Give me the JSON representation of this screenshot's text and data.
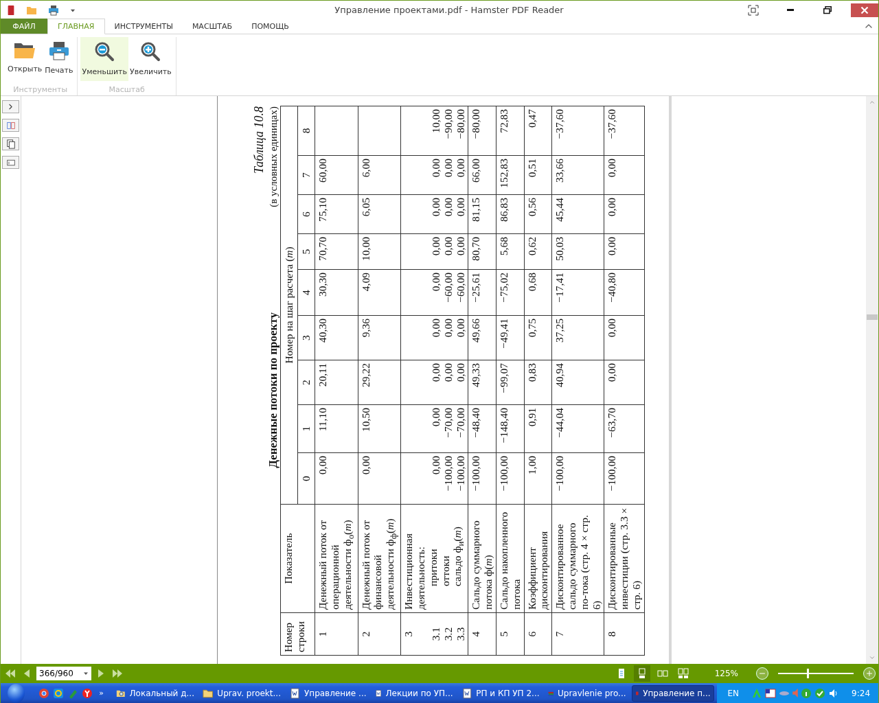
{
  "window": {
    "title": "Управление проектами.pdf - Hamster PDF Reader"
  },
  "tabs": [
    {
      "label": "ФАЙЛ",
      "kind": "file",
      "selected": false
    },
    {
      "label": "ГЛАВНАЯ",
      "kind": "tab",
      "selected": true
    },
    {
      "label": "ИНСТРУМЕНТЫ",
      "kind": "tab",
      "selected": false
    },
    {
      "label": "МАСШТАБ",
      "kind": "tab",
      "selected": false
    },
    {
      "label": "ПОМОЩЬ",
      "kind": "tab",
      "selected": false
    }
  ],
  "ribbon_groups": [
    {
      "label": "Инструменты",
      "buttons": [
        {
          "label": "Открыть",
          "kind": "open",
          "highlighted": false
        },
        {
          "label": "Печать",
          "kind": "print",
          "highlighted": false
        }
      ]
    },
    {
      "label": "Масштаб",
      "buttons": [
        {
          "label": "Уменьшить",
          "kind": "zoom-out",
          "highlighted": true
        },
        {
          "label": "Увеличить",
          "kind": "zoom-in",
          "highlighted": false
        }
      ]
    }
  ],
  "document": {
    "table_label": "Таблица 10.8",
    "title": "Денежные потоки по проекту",
    "units": "(в условных единицах)",
    "columns": [
      "Номер строки",
      "Показатель"
    ],
    "step_header": "Номер на шаг расчета (*m*)",
    "steps": [
      "0",
      "1",
      "2",
      "3",
      "4",
      "5",
      "6",
      "7",
      "8"
    ],
    "rows": [
      {
        "kind": "plain",
        "number": "1",
        "indicator": "Денежный поток от операционной деятельности ф$_{о}$(*m*)",
        "values": [
          "0,00",
          "11,10",
          "20,11",
          "40,30",
          "30,30",
          "70,70",
          "75,10",
          "60,00"
        ]
      },
      {
        "kind": "plain",
        "number": "2",
        "indicator": "Денежный поток от финансовой деятельности ф$_{ф}$(*m*)",
        "values": [
          "0,00",
          "10,50",
          "29,22",
          "9,36",
          "4,09",
          "10,00",
          "6,05",
          "6,00"
        ]
      },
      {
        "kind": "group",
        "number": "3",
        "indicator": "Инвестиционная деятельность:",
        "subrows": [
          {
            "number": "3.1",
            "indicator": "притоки",
            "values": [
              "0,00",
              "0,00",
              "0,00",
              "0,00",
              "0,00",
              "0,00",
              "0,00",
              "0,00",
              "10,00"
            ]
          },
          {
            "number": "3.2",
            "indicator": "оттоки",
            "values": [
              "−100,00",
              "−70,00",
              "0,00",
              "0,00",
              "−60,00",
              "0,00",
              "0,00",
              "0,00",
              "−90,00"
            ]
          },
          {
            "number": "3.3",
            "indicator": "сальдо ф$_{и}$(*m*)",
            "values": [
              "−100,00",
              "−70,00",
              "0,00",
              "0,00",
              "−60,00",
              "0,00",
              "0,00",
              "0,00",
              "−80,00"
            ]
          }
        ]
      },
      {
        "kind": "plain",
        "number": "4",
        "indicator": "Сальдо суммарного потока ф(*m*)",
        "values": [
          "−100,00",
          "−48,40",
          "49,33",
          "49,66",
          "−25,61",
          "80,70",
          "81,15",
          "66,00",
          "−80,00"
        ]
      },
      {
        "kind": "plain",
        "number": "5",
        "indicator": "Сальдо накопленного потока",
        "values": [
          "−100,00",
          "−148,40",
          "−99,07",
          "−49,41",
          "−75,02",
          "5,68",
          "86,83",
          "152,83",
          "72,83"
        ]
      },
      {
        "kind": "plain",
        "number": "6",
        "indicator": "Коэффициент дисконтирования",
        "values": [
          "1,00",
          "0,91",
          "0,83",
          "0,75",
          "0,68",
          "0,62",
          "0,56",
          "0,51",
          "0,47"
        ]
      },
      {
        "kind": "plain",
        "number": "7",
        "indicator": "Дисконтированное сальдо суммарного по-тока (стр. 4 × стр. 6)",
        "values": [
          "−100,00",
          "−44,04",
          "40,94",
          "37,25",
          "−17,41",
          "50,03",
          "45,44",
          "33,66",
          "−37,60"
        ]
      },
      {
        "kind": "plain",
        "number": "8",
        "indicator": "Дисконтированные инвестиции (стр. 3.3 × стр. 6)",
        "values": [
          "−100,00",
          "−63,70",
          "0,00",
          "0,00",
          "−40,80",
          "0,00",
          "0,00",
          "0,00",
          "−37,60"
        ]
      }
    ]
  },
  "status_bar": {
    "page": "366/960",
    "zoom": "125%",
    "zoom_slider": {
      "level": 0.38
    },
    "view_modes": [
      {
        "kind": "single",
        "selected": false
      },
      {
        "kind": "continuous",
        "selected": true
      },
      {
        "kind": "facing",
        "selected": false
      },
      {
        "kind": "facing-continuous",
        "selected": false
      }
    ]
  },
  "taskbar": {
    "tasks": [
      {
        "label": "Локальный д...",
        "kind": "drive",
        "selected": false
      },
      {
        "label": "Uprav. proekt...",
        "kind": "folder",
        "selected": false
      },
      {
        "label": "Управление ...",
        "kind": "word",
        "selected": false
      },
      {
        "label": "Лекции по УП...",
        "kind": "word",
        "selected": false
      },
      {
        "label": "РП и КП  УП 2...",
        "kind": "word",
        "selected": false
      },
      {
        "label": "Upravlenie pro...",
        "kind": "archive",
        "selected": false
      },
      {
        "label": "Управление п...",
        "kind": "pdf",
        "selected": true
      }
    ],
    "more": "»",
    "language": "EN",
    "clock": "9:24"
  }
}
